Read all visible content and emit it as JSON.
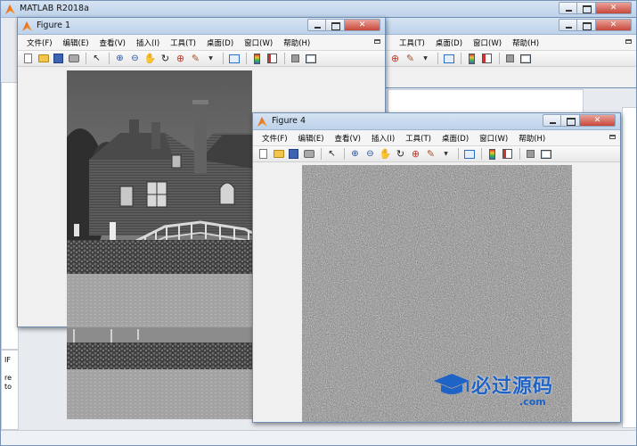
{
  "matlab": {
    "title": "MATLAB R2018a",
    "left_labels": [
      "IF",
      "re",
      "to"
    ]
  },
  "figure_back": {
    "menu": [
      "工具(T)",
      "桌面(D)",
      "窗口(W)",
      "帮助(H)"
    ]
  },
  "figure1": {
    "title": "Figure 1",
    "menu": [
      "文件(F)",
      "编辑(E)",
      "查看(V)",
      "插入(I)",
      "工具(T)",
      "桌面(D)",
      "窗口(W)",
      "帮助(H)"
    ],
    "image": "grayscale-house-photo"
  },
  "figure4": {
    "title": "Figure 4",
    "menu": [
      "文件(F)",
      "编辑(E)",
      "查看(V)",
      "插入(I)",
      "工具(T)",
      "桌面(D)",
      "窗口(W)",
      "帮助(H)"
    ],
    "image": "scrambled-noise-image"
  },
  "toolbar_icons": [
    "new-figure-icon",
    "open-file-icon",
    "save-icon",
    "print-icon",
    "edit-plot-arrow-icon",
    "zoom-in-icon",
    "zoom-out-icon",
    "pan-hand-icon",
    "rotate-3d-icon",
    "data-cursor-icon",
    "brush-icon",
    "link-plot-icon",
    "colorbar-icon",
    "legend-icon",
    "hide-plot-tools-icon",
    "show-plot-tools-icon"
  ],
  "watermark": {
    "cn": "必过源码",
    "en": ".com"
  },
  "colors": {
    "title_gradient_top": "#d6e4f3",
    "title_gradient_bottom": "#bdd2ea",
    "close_red": "#c8473a",
    "watermark_blue": "#1f63c6"
  }
}
